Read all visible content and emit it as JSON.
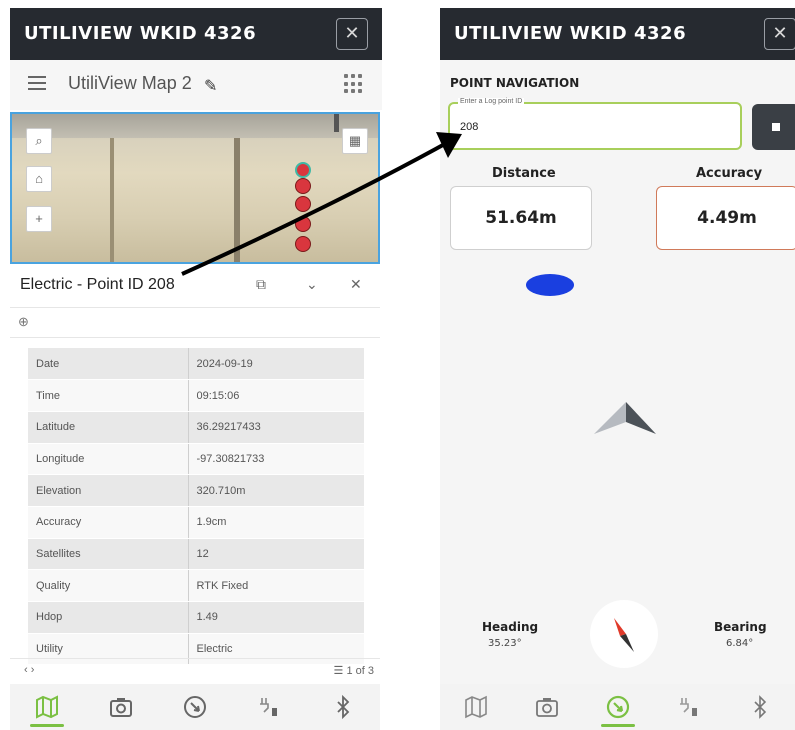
{
  "left": {
    "app_title": "UTILIVIEW WKID 4326",
    "close_glyph": "✕",
    "map_name": "UtiliView Map 2",
    "popup_title": "Electric - Point ID 208",
    "attributes": [
      {
        "key": "Date",
        "value": "2024-09-19"
      },
      {
        "key": "Time",
        "value": "09:15:06"
      },
      {
        "key": "Latitude",
        "value": "36.29217433"
      },
      {
        "key": "Longitude",
        "value": "-97.30821733"
      },
      {
        "key": "Elevation",
        "value": "320.710m"
      },
      {
        "key": "Accuracy",
        "value": "1.9cm"
      },
      {
        "key": "Satellites",
        "value": "12"
      },
      {
        "key": "Quality",
        "value": "RTK Fixed"
      },
      {
        "key": "Hdop",
        "value": "1.49"
      },
      {
        "key": "Utility",
        "value": "Electric"
      }
    ],
    "pager_arrows": "‹   ›",
    "pager_pages": "1 of 3",
    "active_tab": "map"
  },
  "right": {
    "app_title": "UTILIVIEW WKID 4326",
    "close_glyph": "✕",
    "section_label": "POINT NAVIGATION",
    "input_legend": "Enter a Log point ID",
    "input_value": "208",
    "distance_label": "Distance",
    "distance_value": "51.64m",
    "accuracy_label": "Accuracy",
    "accuracy_value": "4.49m",
    "heading_label": "Heading",
    "heading_value": "35.23°",
    "bearing_label": "Bearing",
    "bearing_value": "6.84°",
    "active_tab": "navigation"
  },
  "colors": {
    "topbar": "#262a30",
    "accent_green": "#7bc043",
    "point_red": "#d9363e",
    "location_blue": "#1a3fe0",
    "accuracy_border": "#d07a5a"
  }
}
